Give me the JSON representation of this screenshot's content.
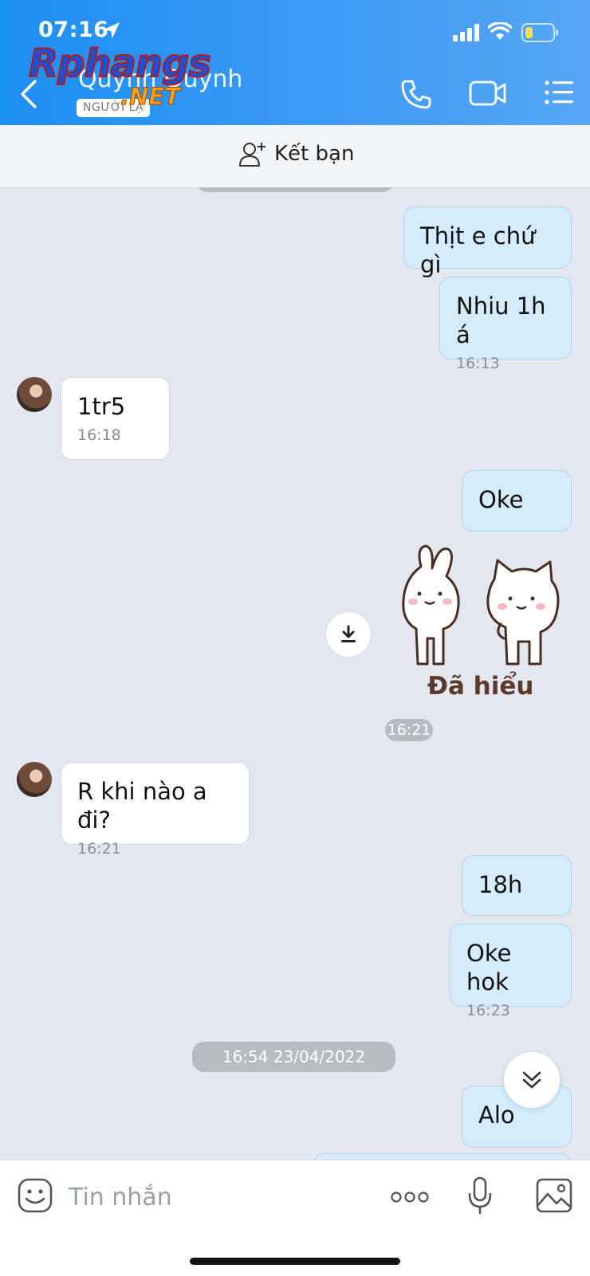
{
  "status_bar": {
    "time": "07:16"
  },
  "header": {
    "contact_name": "Quỳnh Quỳnh",
    "stranger_badge": "NGƯỜI LẠ",
    "watermark_main": "Rphangs",
    "watermark_net": ".NET"
  },
  "add_friend": {
    "label": "Kết bạn"
  },
  "messages": [
    {
      "from": "me",
      "text": "Thịt e chứ gì"
    },
    {
      "from": "me",
      "text": "Nhiu 1h á",
      "time": "16:13"
    },
    {
      "from": "them",
      "text": "1tr5",
      "time": "16:18"
    },
    {
      "from": "me",
      "text": "Oke"
    },
    {
      "from": "me",
      "type": "sticker",
      "sticker_text": "Đã hiểu",
      "time": "16:21"
    },
    {
      "from": "them",
      "text": "R khi nào a đi?",
      "time": "16:21"
    },
    {
      "from": "me",
      "text": "18h"
    },
    {
      "from": "me",
      "text": "Oke hok",
      "time": "16:23"
    },
    {
      "type": "date_separator",
      "text": "16:54 23/04/2022"
    },
    {
      "from": "me",
      "text": "Alo"
    }
  ],
  "composer": {
    "placeholder": "Tin nhắn"
  },
  "icons": {
    "back": "chevron-left-icon",
    "call": "phone-icon",
    "video": "video-camera-icon",
    "menu": "list-menu-icon",
    "add_friend": "add-user-icon",
    "download": "download-icon",
    "scroll_down": "double-chevron-down-icon",
    "sticker": "emoji-icon",
    "more": "more-dots-icon",
    "mic": "microphone-icon",
    "image": "image-icon"
  },
  "colors": {
    "header": "#3d9af5",
    "my_bubble": "#d5ecfc",
    "their_bubble": "#ffffff",
    "chat_bg": "#e3e7ef"
  }
}
